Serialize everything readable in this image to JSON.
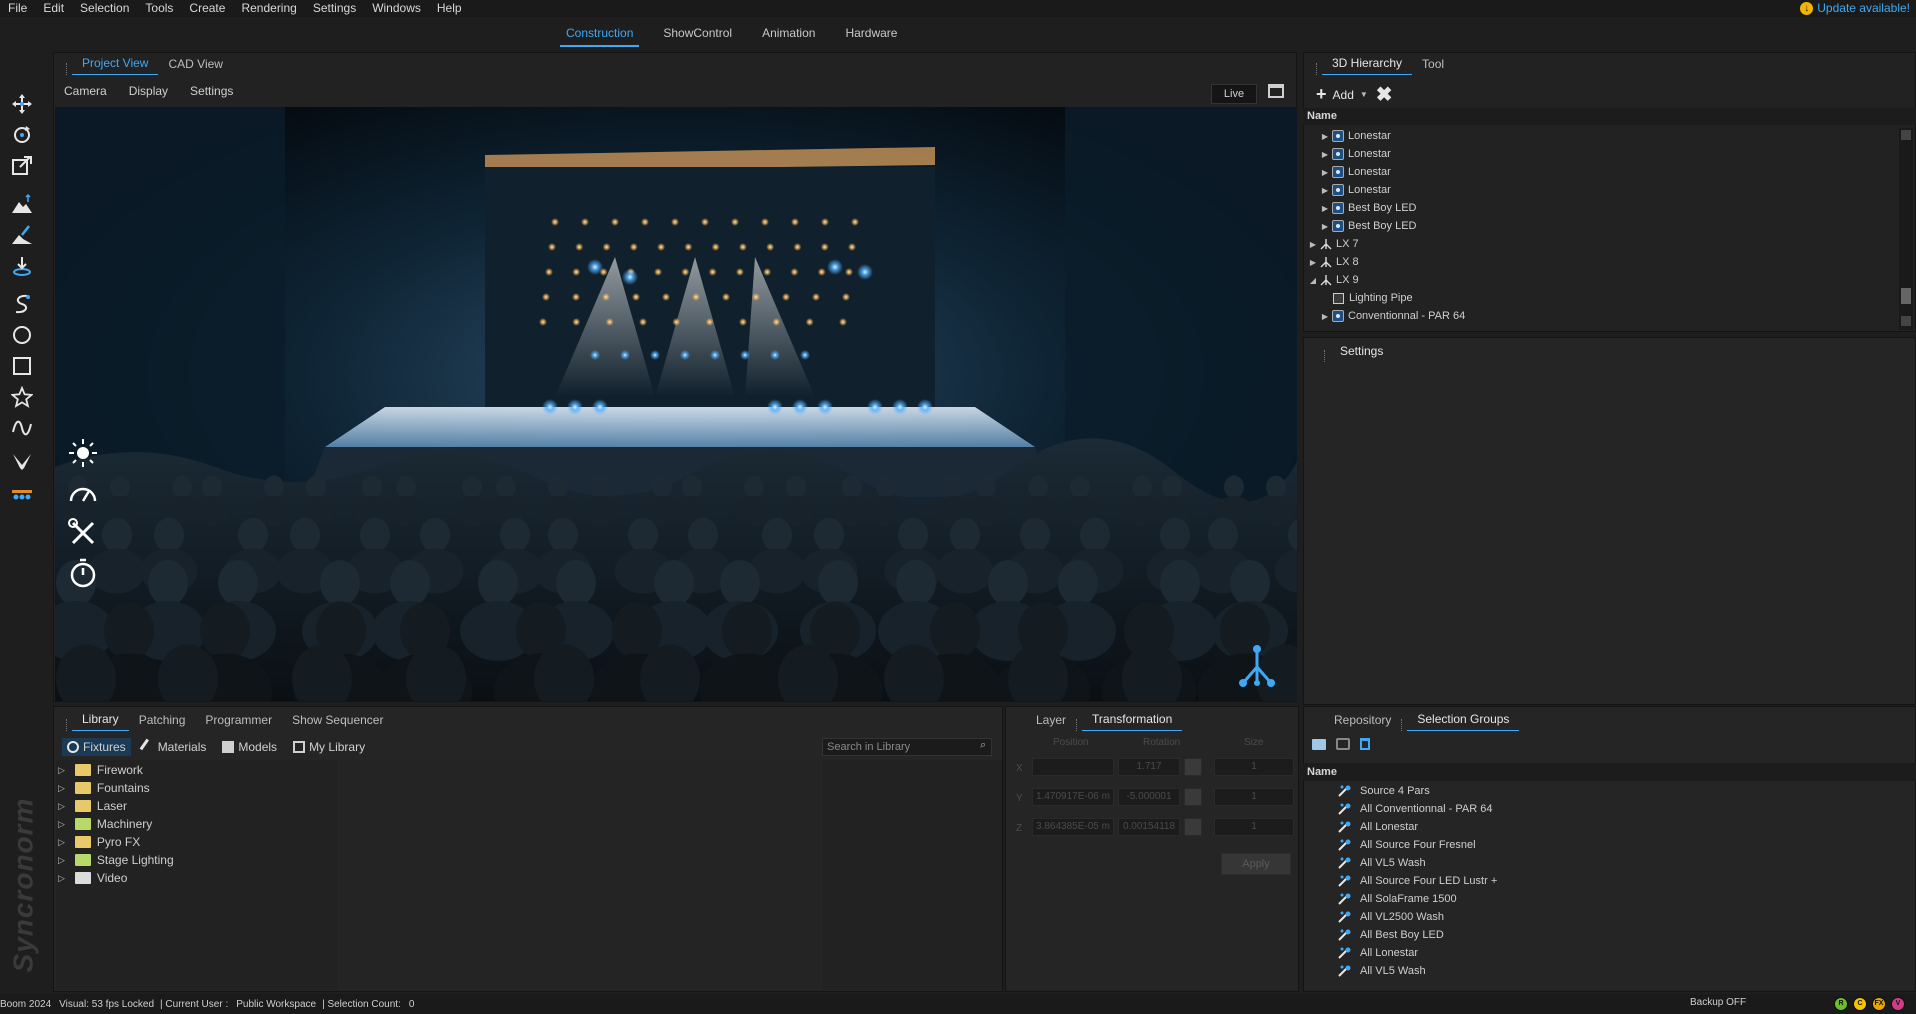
{
  "menu": {
    "items": [
      "File",
      "Edit",
      "Selection",
      "Tools",
      "Create",
      "Rendering",
      "Settings",
      "Windows",
      "Help"
    ],
    "update": "Update available!"
  },
  "modes": [
    "Construction",
    "ShowControl",
    "Animation",
    "Hardware"
  ],
  "viewport": {
    "tabs": [
      "Project View",
      "CAD View"
    ],
    "subtabs": [
      "Camera",
      "Display",
      "Settings"
    ],
    "live": "Live"
  },
  "hierarchy": {
    "tabs": [
      "3D Hierarchy",
      "Tool"
    ],
    "add": "Add",
    "column": "Name",
    "rows": [
      {
        "label": "Lonestar",
        "icon": "fixture-icon",
        "level": 1,
        "arrow": "right"
      },
      {
        "label": "Lonestar",
        "icon": "fixture-icon",
        "level": 1,
        "arrow": "right"
      },
      {
        "label": "Lonestar",
        "icon": "fixture-icon",
        "level": 1,
        "arrow": "right"
      },
      {
        "label": "Lonestar",
        "icon": "fixture-icon",
        "level": 1,
        "arrow": "right"
      },
      {
        "label": "Best Boy LED",
        "icon": "fixture-icon",
        "level": 1,
        "arrow": "right"
      },
      {
        "label": "Best Boy LED",
        "icon": "fixture-icon",
        "level": 1,
        "arrow": "right"
      },
      {
        "label": "LX 7",
        "icon": "truss-icon",
        "level": 0,
        "arrow": "right"
      },
      {
        "label": "LX 8",
        "icon": "truss-icon",
        "level": 0,
        "arrow": "right"
      },
      {
        "label": "LX 9",
        "icon": "truss-icon",
        "level": 0,
        "arrow": "down"
      },
      {
        "label": "Lighting Pipe",
        "icon": "pipe-icon",
        "level": 1,
        "arrow": ""
      },
      {
        "label": "Conventionnal - PAR 64",
        "icon": "fixture-icon",
        "level": 1,
        "arrow": "right"
      }
    ]
  },
  "settings": {
    "title": "Settings"
  },
  "library": {
    "tabs": [
      "Library",
      "Patching",
      "Programmer",
      "Show Sequencer"
    ],
    "categories": [
      "Fixtures",
      "Materials",
      "Models",
      "My Library"
    ],
    "search_placeholder": "Search in Library",
    "folders": [
      {
        "label": "Firework",
        "color": "yellow"
      },
      {
        "label": "Fountains",
        "color": "yellow"
      },
      {
        "label": "Laser",
        "color": "yellow"
      },
      {
        "label": "Machinery",
        "color": "green"
      },
      {
        "label": "Pyro FX",
        "color": "yellow"
      },
      {
        "label": "Stage Lighting",
        "color": "green"
      },
      {
        "label": "Video",
        "color": "white"
      }
    ]
  },
  "transformation": {
    "tabs": [
      "Layer",
      "Transformation"
    ],
    "headers": [
      "Position",
      "Rotation",
      "Size"
    ],
    "axes": [
      "X",
      "Y",
      "Z"
    ],
    "rows": [
      {
        "position": "",
        "rotation": "1.717",
        "size": "1"
      },
      {
        "position": "1.470917E-06 m",
        "rotation": "-5.000001",
        "size": "1"
      },
      {
        "position": "3.864385E-05 m",
        "rotation": "0.00154118",
        "size": "1"
      }
    ],
    "apply": "Apply"
  },
  "selection": {
    "tabs": [
      "Repository",
      "Selection Groups"
    ],
    "column": "Name",
    "groups": [
      "Source 4 Pars",
      "All Conventionnal - PAR 64",
      "All Lonestar",
      "All Source Four Fresnel",
      "All VL5 Wash",
      "All Source Four LED Lustr +",
      "All SolaFrame 1500",
      "All VL2500 Wash",
      "All Best Boy LED",
      "All Lonestar",
      "All VL5 Wash"
    ]
  },
  "status": {
    "app": "Boom 2024",
    "visual": "Visual: 53 fps Locked",
    "user_label": "| Current User :",
    "user": "Public Workspace",
    "selection_label": "| Selection Count:",
    "selection_count": "0",
    "backup": "Backup OFF",
    "indicators": [
      "R",
      "C",
      "FX",
      "V"
    ]
  },
  "brand": "Syncronorm",
  "colors": {
    "accent": "#3fa9f5",
    "update": "#f5b400"
  }
}
